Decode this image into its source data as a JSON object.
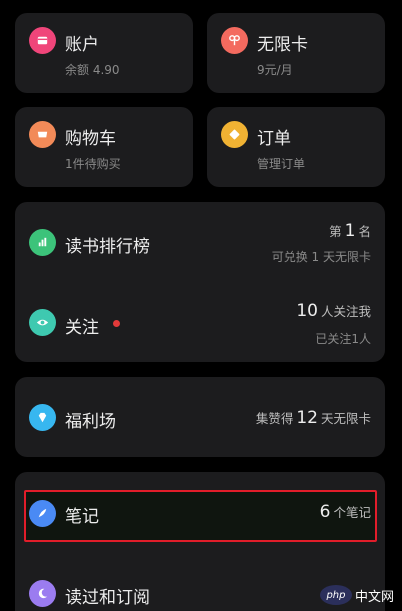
{
  "grid": [
    {
      "title": "账户",
      "sub": "余额 4.90",
      "icon": "wallet-icon",
      "color": "#f0457a"
    },
    {
      "title": "无限卡",
      "sub": "9元/月",
      "icon": "ribbon-icon",
      "color": "#f36a5f"
    },
    {
      "title": "购物车",
      "sub": "1件待购买",
      "icon": "cart-icon",
      "color": "#f28a58"
    },
    {
      "title": "订单",
      "sub": "管理订单",
      "icon": "order-icon",
      "color": "#f0b233"
    }
  ],
  "ranking": {
    "title": "读书排行榜",
    "rank_prefix": "第",
    "rank_value": "1",
    "rank_suffix": "名",
    "sub": "可兑换 1 天无限卡",
    "icon": "bar-chart-icon",
    "color": "#3cc37a"
  },
  "follow": {
    "title": "关注",
    "count": "10",
    "count_suffix": "人关注我",
    "sub": "已关注1人",
    "icon": "eye-icon",
    "color": "#3ec9b0",
    "dot_color": "#e23a3a"
  },
  "welfare": {
    "title": "福利场",
    "prefix": "集赞得",
    "value": "12",
    "suffix": "天无限卡",
    "icon": "diamond-icon",
    "color": "#37b7f0"
  },
  "notes": {
    "title": "笔记",
    "count": "6",
    "suffix": "个笔记",
    "icon": "feather-icon",
    "color": "#4a8af4"
  },
  "history": {
    "title": "读过和订阅",
    "icon": "moon-icon",
    "color": "#9b7cf0"
  },
  "watermark": {
    "logo": "php",
    "text": "中文网"
  }
}
